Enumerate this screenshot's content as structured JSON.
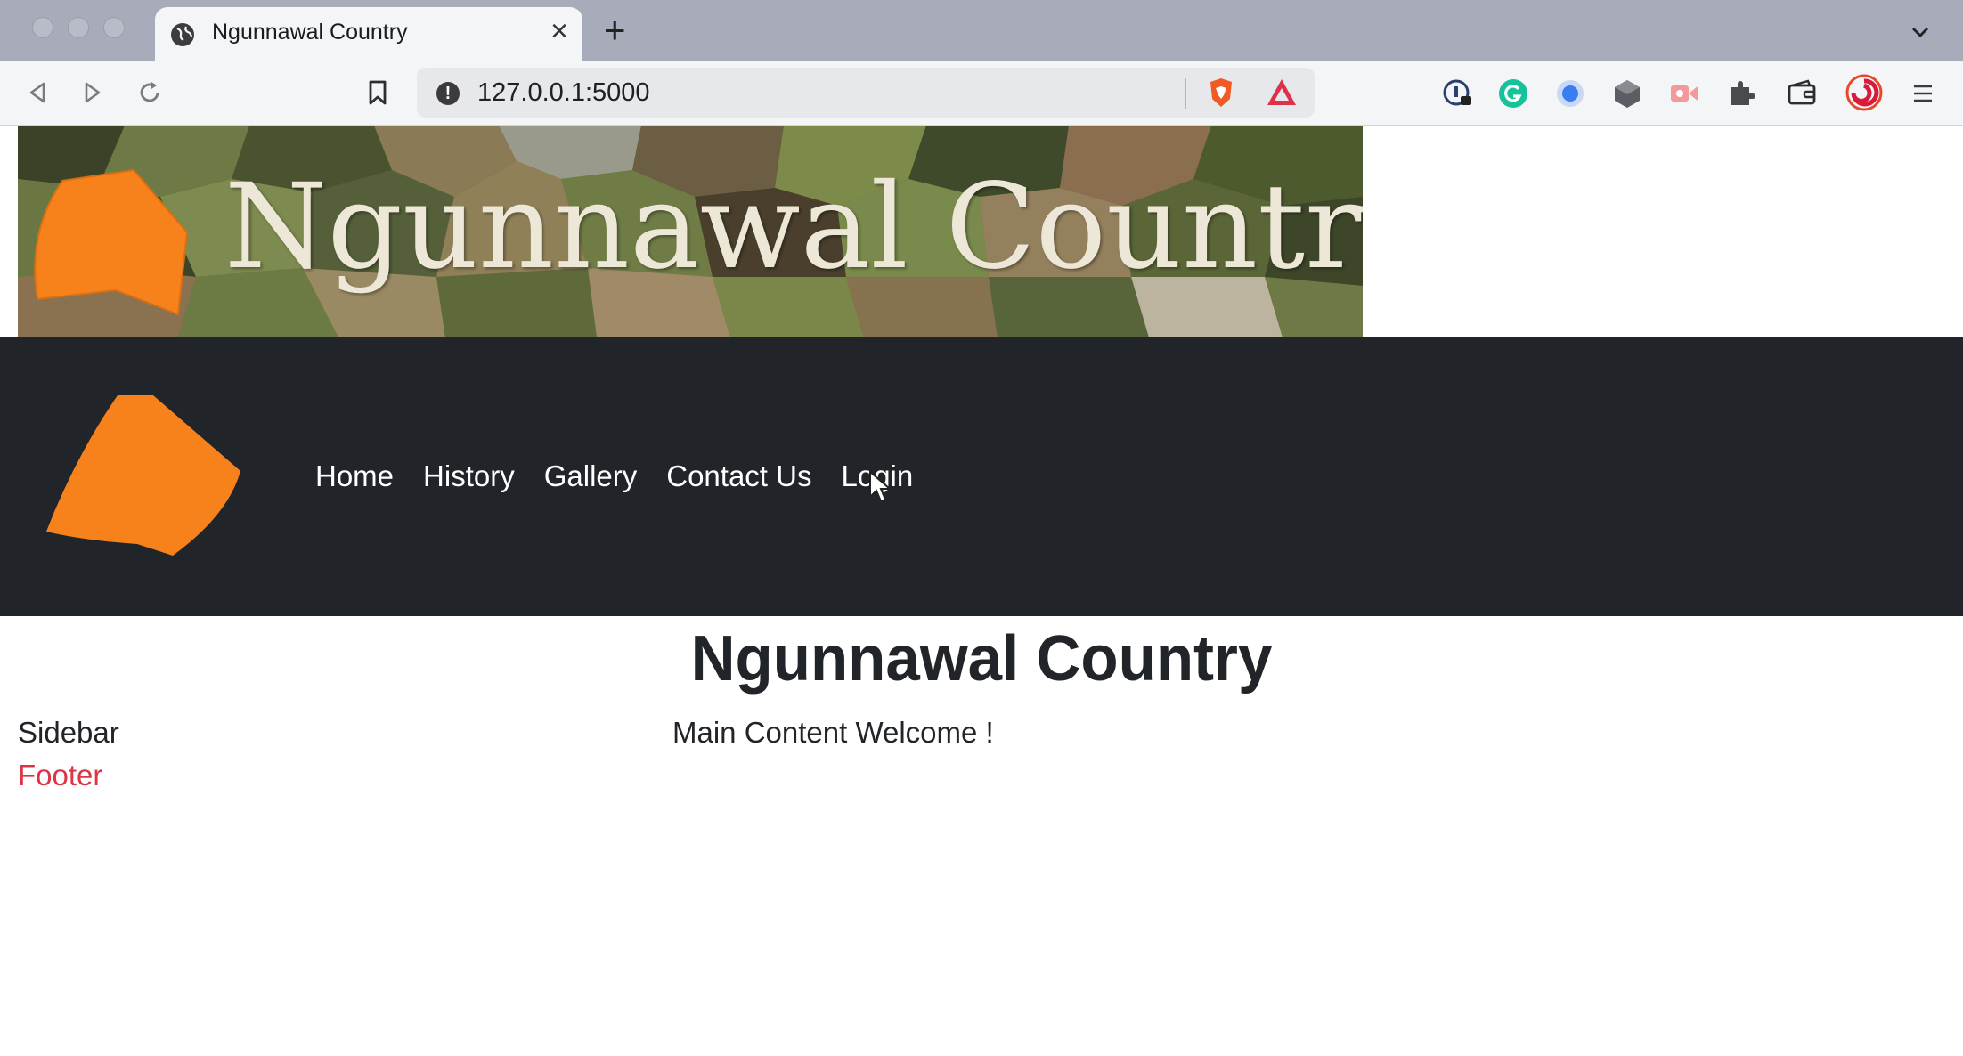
{
  "browser": {
    "tab_title": "Ngunnawal Country",
    "tab_close": "×",
    "new_tab": "+",
    "url": "127.0.0.1:5000",
    "info_icon_text": "!"
  },
  "banner": {
    "title": "Ngunnawal Country"
  },
  "navbar": {
    "links": [
      "Home",
      "History",
      "Gallery",
      "Contact Us",
      "Login"
    ]
  },
  "main": {
    "heading": "Ngunnawal Country",
    "sidebar": "Sidebar",
    "content": "Main Content Welcome !",
    "footer": "Footer"
  },
  "colors": {
    "navbar_bg": "#212529",
    "logo_orange": "#f7821b",
    "footer_red": "#dc3545"
  }
}
